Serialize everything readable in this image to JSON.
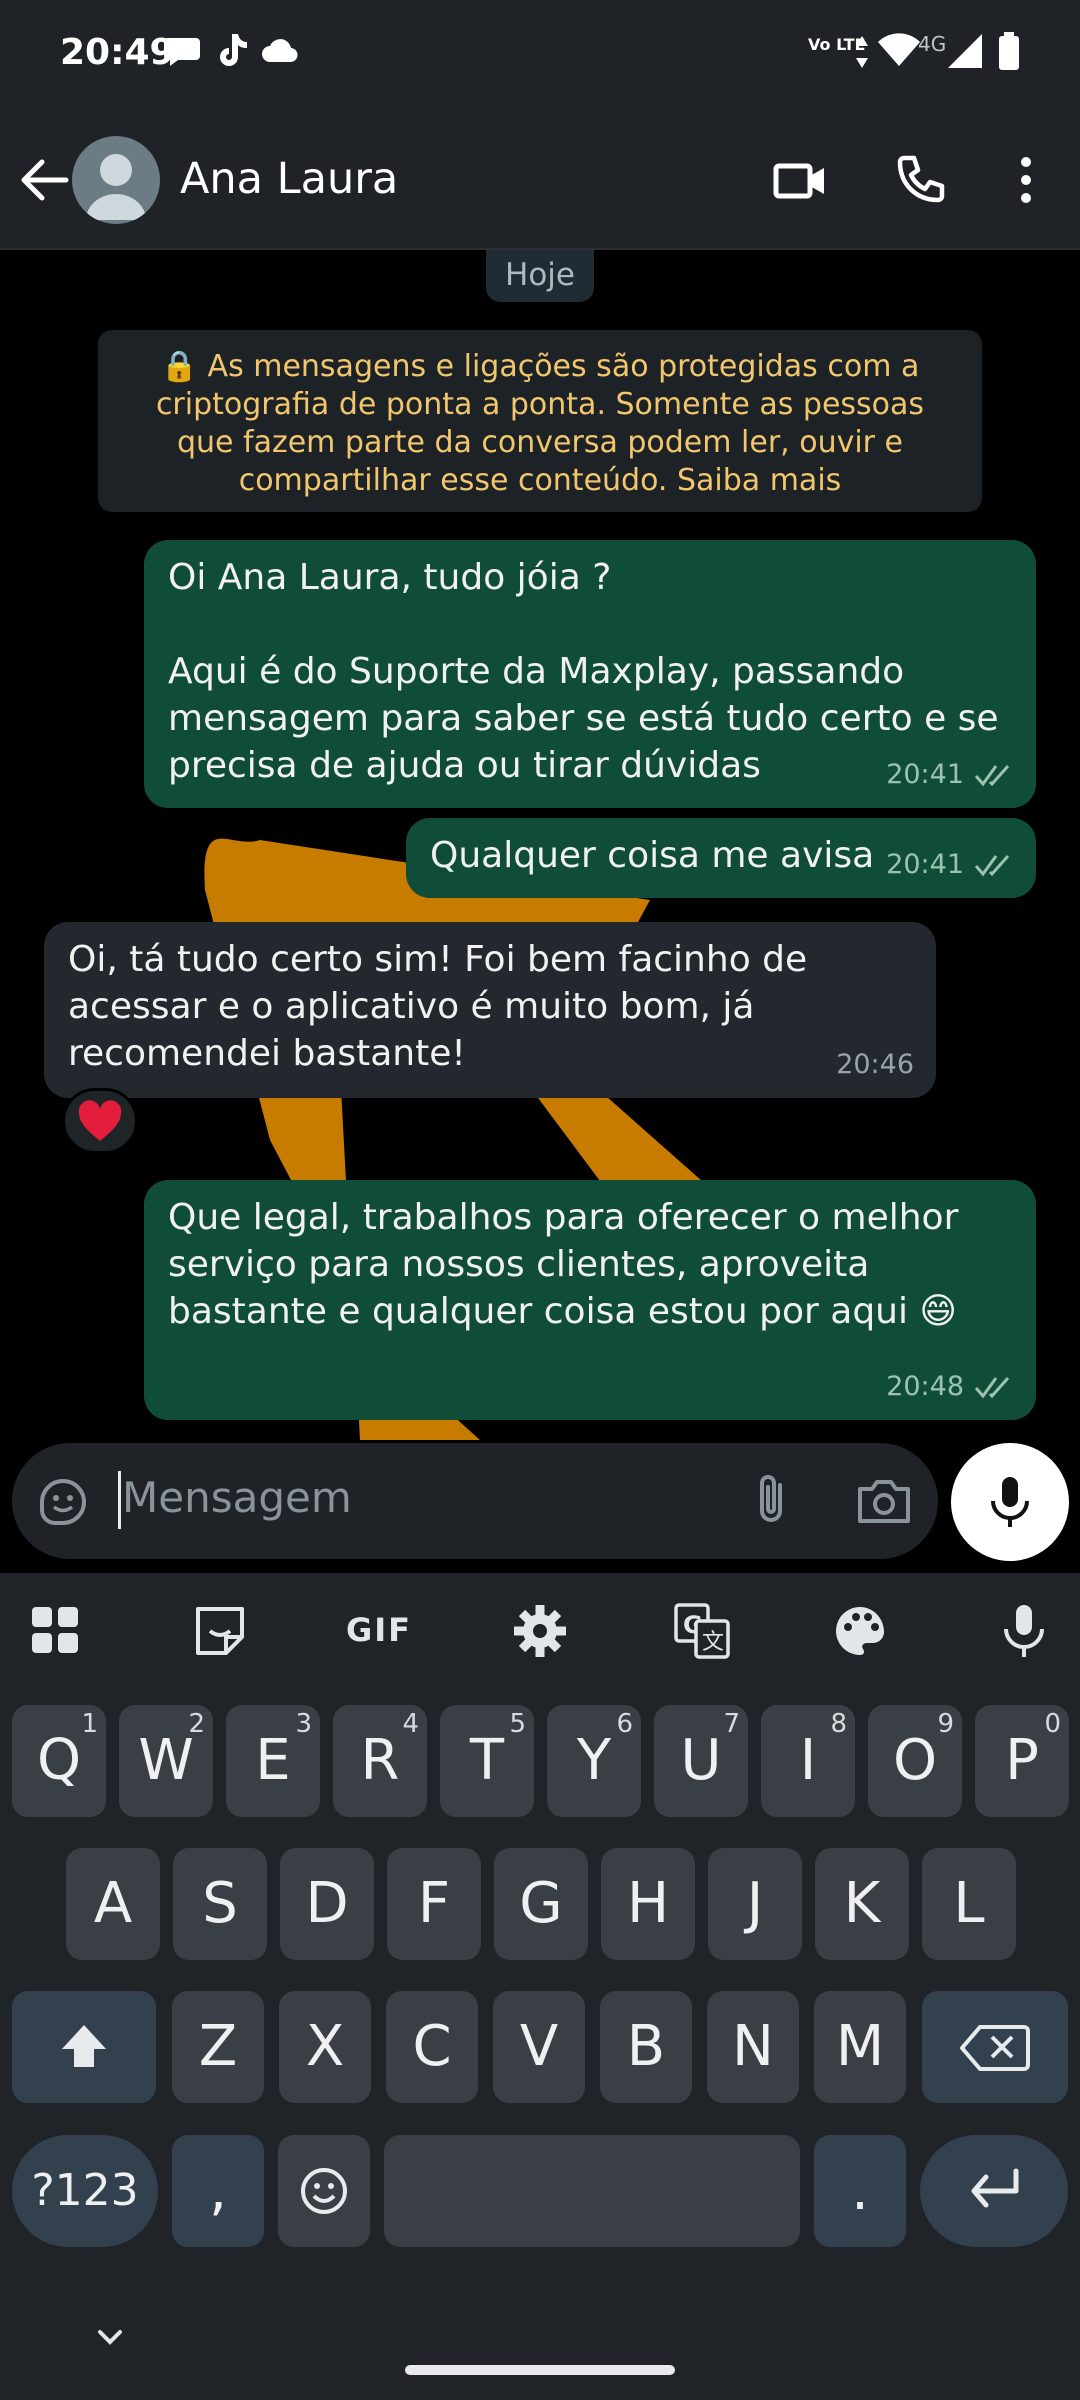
{
  "status_bar": {
    "time": "20:49",
    "network": "4G",
    "volte": "Vo LTE",
    "notification_icons": [
      "chat-bubble-icon",
      "tiktok-icon",
      "cloud-icon"
    ],
    "system_icons": [
      "volte-icon",
      "data-arrows-icon",
      "wifi-icon",
      "signal-icon",
      "battery-icon"
    ]
  },
  "header": {
    "contact_name": "Ana Laura",
    "actions": [
      "back-arrow-icon",
      "video-call-icon",
      "voice-call-icon",
      "more-options-icon"
    ]
  },
  "chat": {
    "date_chip": "Hoje",
    "encryption_notice": "🔒 As mensagens e ligações são protegidas com a criptografia de ponta a ponta. Somente as pessoas que fazem parte da conversa podem ler, ouvir e compartilhar esse conteúdo. Saiba mais",
    "messages": [
      {
        "direction": "out",
        "text": "Oi Ana Laura, tudo jóia ?\n\nAqui é do Suporte da Maxplay, passando mensagem para saber se está tudo certo e se precisa de ajuda ou tirar dúvidas",
        "time": "20:41",
        "status": "read"
      },
      {
        "direction": "out",
        "text": "Qualquer coisa me avisa",
        "time": "20:41",
        "status": "read"
      },
      {
        "direction": "in",
        "text": "Oi, tá tudo certo sim! Foi bem facinho de acessar e o aplicativo é muito bom, já recomendei bastante!",
        "time": "20:46",
        "reaction": "❤️"
      },
      {
        "direction": "out",
        "text": "Que legal, trabalhos para oferecer o melhor serviço para nossos clientes, aproveita bastante e qualquer coisa estou por aqui 😄",
        "time": "20:48",
        "status": "read"
      }
    ]
  },
  "composer": {
    "placeholder": "Mensagem",
    "icons": [
      "sticker-icon",
      "attach-clip-icon",
      "camera-icon",
      "microphone-icon"
    ]
  },
  "keyboard": {
    "toolbar": [
      "apps-grid-icon",
      "sticker-icon",
      "GIF",
      "settings-gear-icon",
      "translate-icon",
      "palette-icon",
      "voice-input-icon"
    ],
    "gif_label": "GIF",
    "row1": [
      {
        "k": "Q",
        "n": "1"
      },
      {
        "k": "W",
        "n": "2"
      },
      {
        "k": "E",
        "n": "3"
      },
      {
        "k": "R",
        "n": "4"
      },
      {
        "k": "T",
        "n": "5"
      },
      {
        "k": "Y",
        "n": "6"
      },
      {
        "k": "U",
        "n": "7"
      },
      {
        "k": "I",
        "n": "8"
      },
      {
        "k": "O",
        "n": "9"
      },
      {
        "k": "P",
        "n": "0"
      }
    ],
    "row2": [
      "A",
      "S",
      "D",
      "F",
      "G",
      "H",
      "J",
      "K",
      "L"
    ],
    "row3": [
      "Z",
      "X",
      "C",
      "V",
      "B",
      "N",
      "M"
    ],
    "symbols_label": "?123",
    "comma": ",",
    "period": ".",
    "icons": [
      "shift-icon",
      "backspace-icon",
      "emoji-icon",
      "enter-icon",
      "hide-keyboard-chevron-icon"
    ]
  },
  "colors": {
    "outgoing_bubble": "#104d38",
    "incoming_bubble": "#22282d",
    "header_bg": "#1f2327",
    "encryption_text": "#f2c66d",
    "wallpaper_accent": "#c77c00",
    "read_ticks": "#9cc3b1"
  }
}
